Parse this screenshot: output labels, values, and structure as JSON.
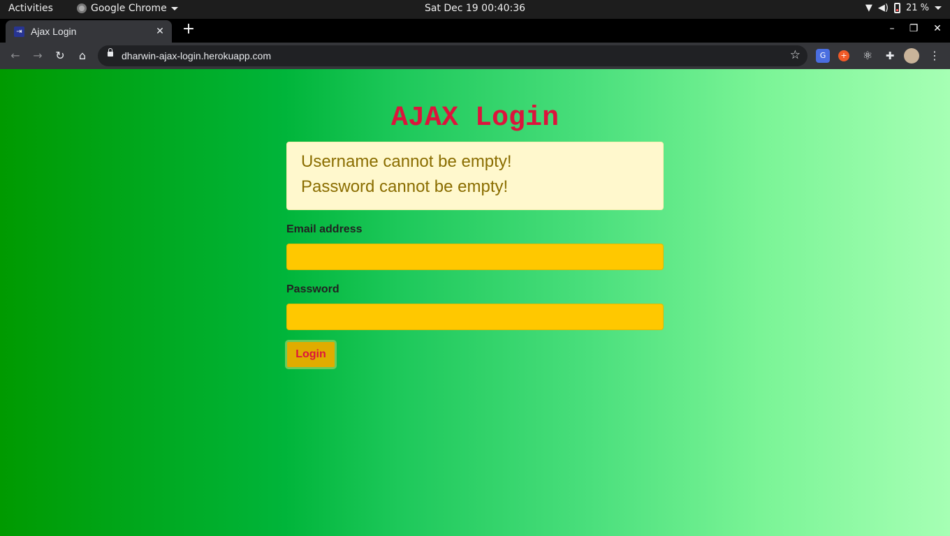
{
  "os_topbar": {
    "activities_label": "Activities",
    "app_name": "Google Chrome",
    "clock": "Sat Dec 19  00:40:36",
    "battery_percent": "21 %"
  },
  "browser": {
    "tab_title": "Ajax Login",
    "url": "dharwin-ajax-login.herokuapp.com"
  },
  "page": {
    "heading": "AJAX Login",
    "alert": {
      "messages": [
        "Username cannot be empty!",
        "Password cannot be empty!"
      ]
    },
    "email_label": "Email address",
    "email_value": "",
    "password_label": "Password",
    "password_value": "",
    "login_button_label": "Login"
  },
  "colors": {
    "heading": "#dc143c",
    "field_background": "#ffc800",
    "alert_background": "#fff8cd",
    "alert_text": "#8a6d00",
    "button_background": "#e0ac00"
  }
}
